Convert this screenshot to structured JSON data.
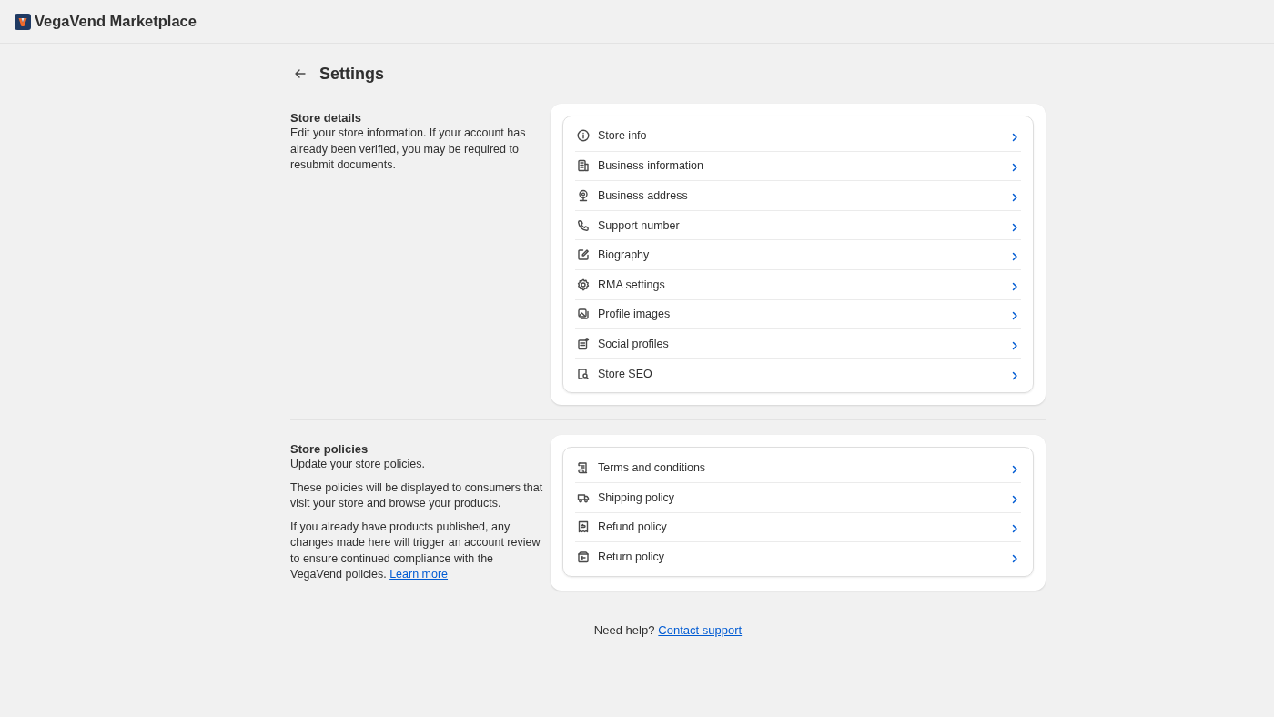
{
  "app": {
    "title": "VegaVend Marketplace"
  },
  "page": {
    "title": "Settings"
  },
  "sections": [
    {
      "title": "Store details",
      "paragraphs": [
        {
          "text": "Edit your store information. If your account has already been verified, you may be required to resubmit documents."
        }
      ],
      "items": [
        {
          "label": "Store info"
        },
        {
          "label": "Business information"
        },
        {
          "label": "Business address"
        },
        {
          "label": "Support number"
        },
        {
          "label": "Biography"
        },
        {
          "label": "RMA settings"
        },
        {
          "label": "Profile images"
        },
        {
          "label": "Social profiles"
        },
        {
          "label": "Store SEO"
        }
      ]
    },
    {
      "title": "Store policies",
      "paragraphs": [
        {
          "text": "Update your store policies."
        },
        {
          "text": "These policies will be displayed to consumers that visit your store and browse your products."
        },
        {
          "text": "If you already have products published, any changes made here will trigger an account review to ensure continued compliance with the VegaVend policies.",
          "link": "Learn more"
        }
      ],
      "items": [
        {
          "label": "Terms and conditions"
        },
        {
          "label": "Shipping policy"
        },
        {
          "label": "Refund policy"
        },
        {
          "label": "Return policy"
        }
      ]
    }
  ],
  "footer": {
    "text": "Need help?",
    "link": "Contact support"
  }
}
